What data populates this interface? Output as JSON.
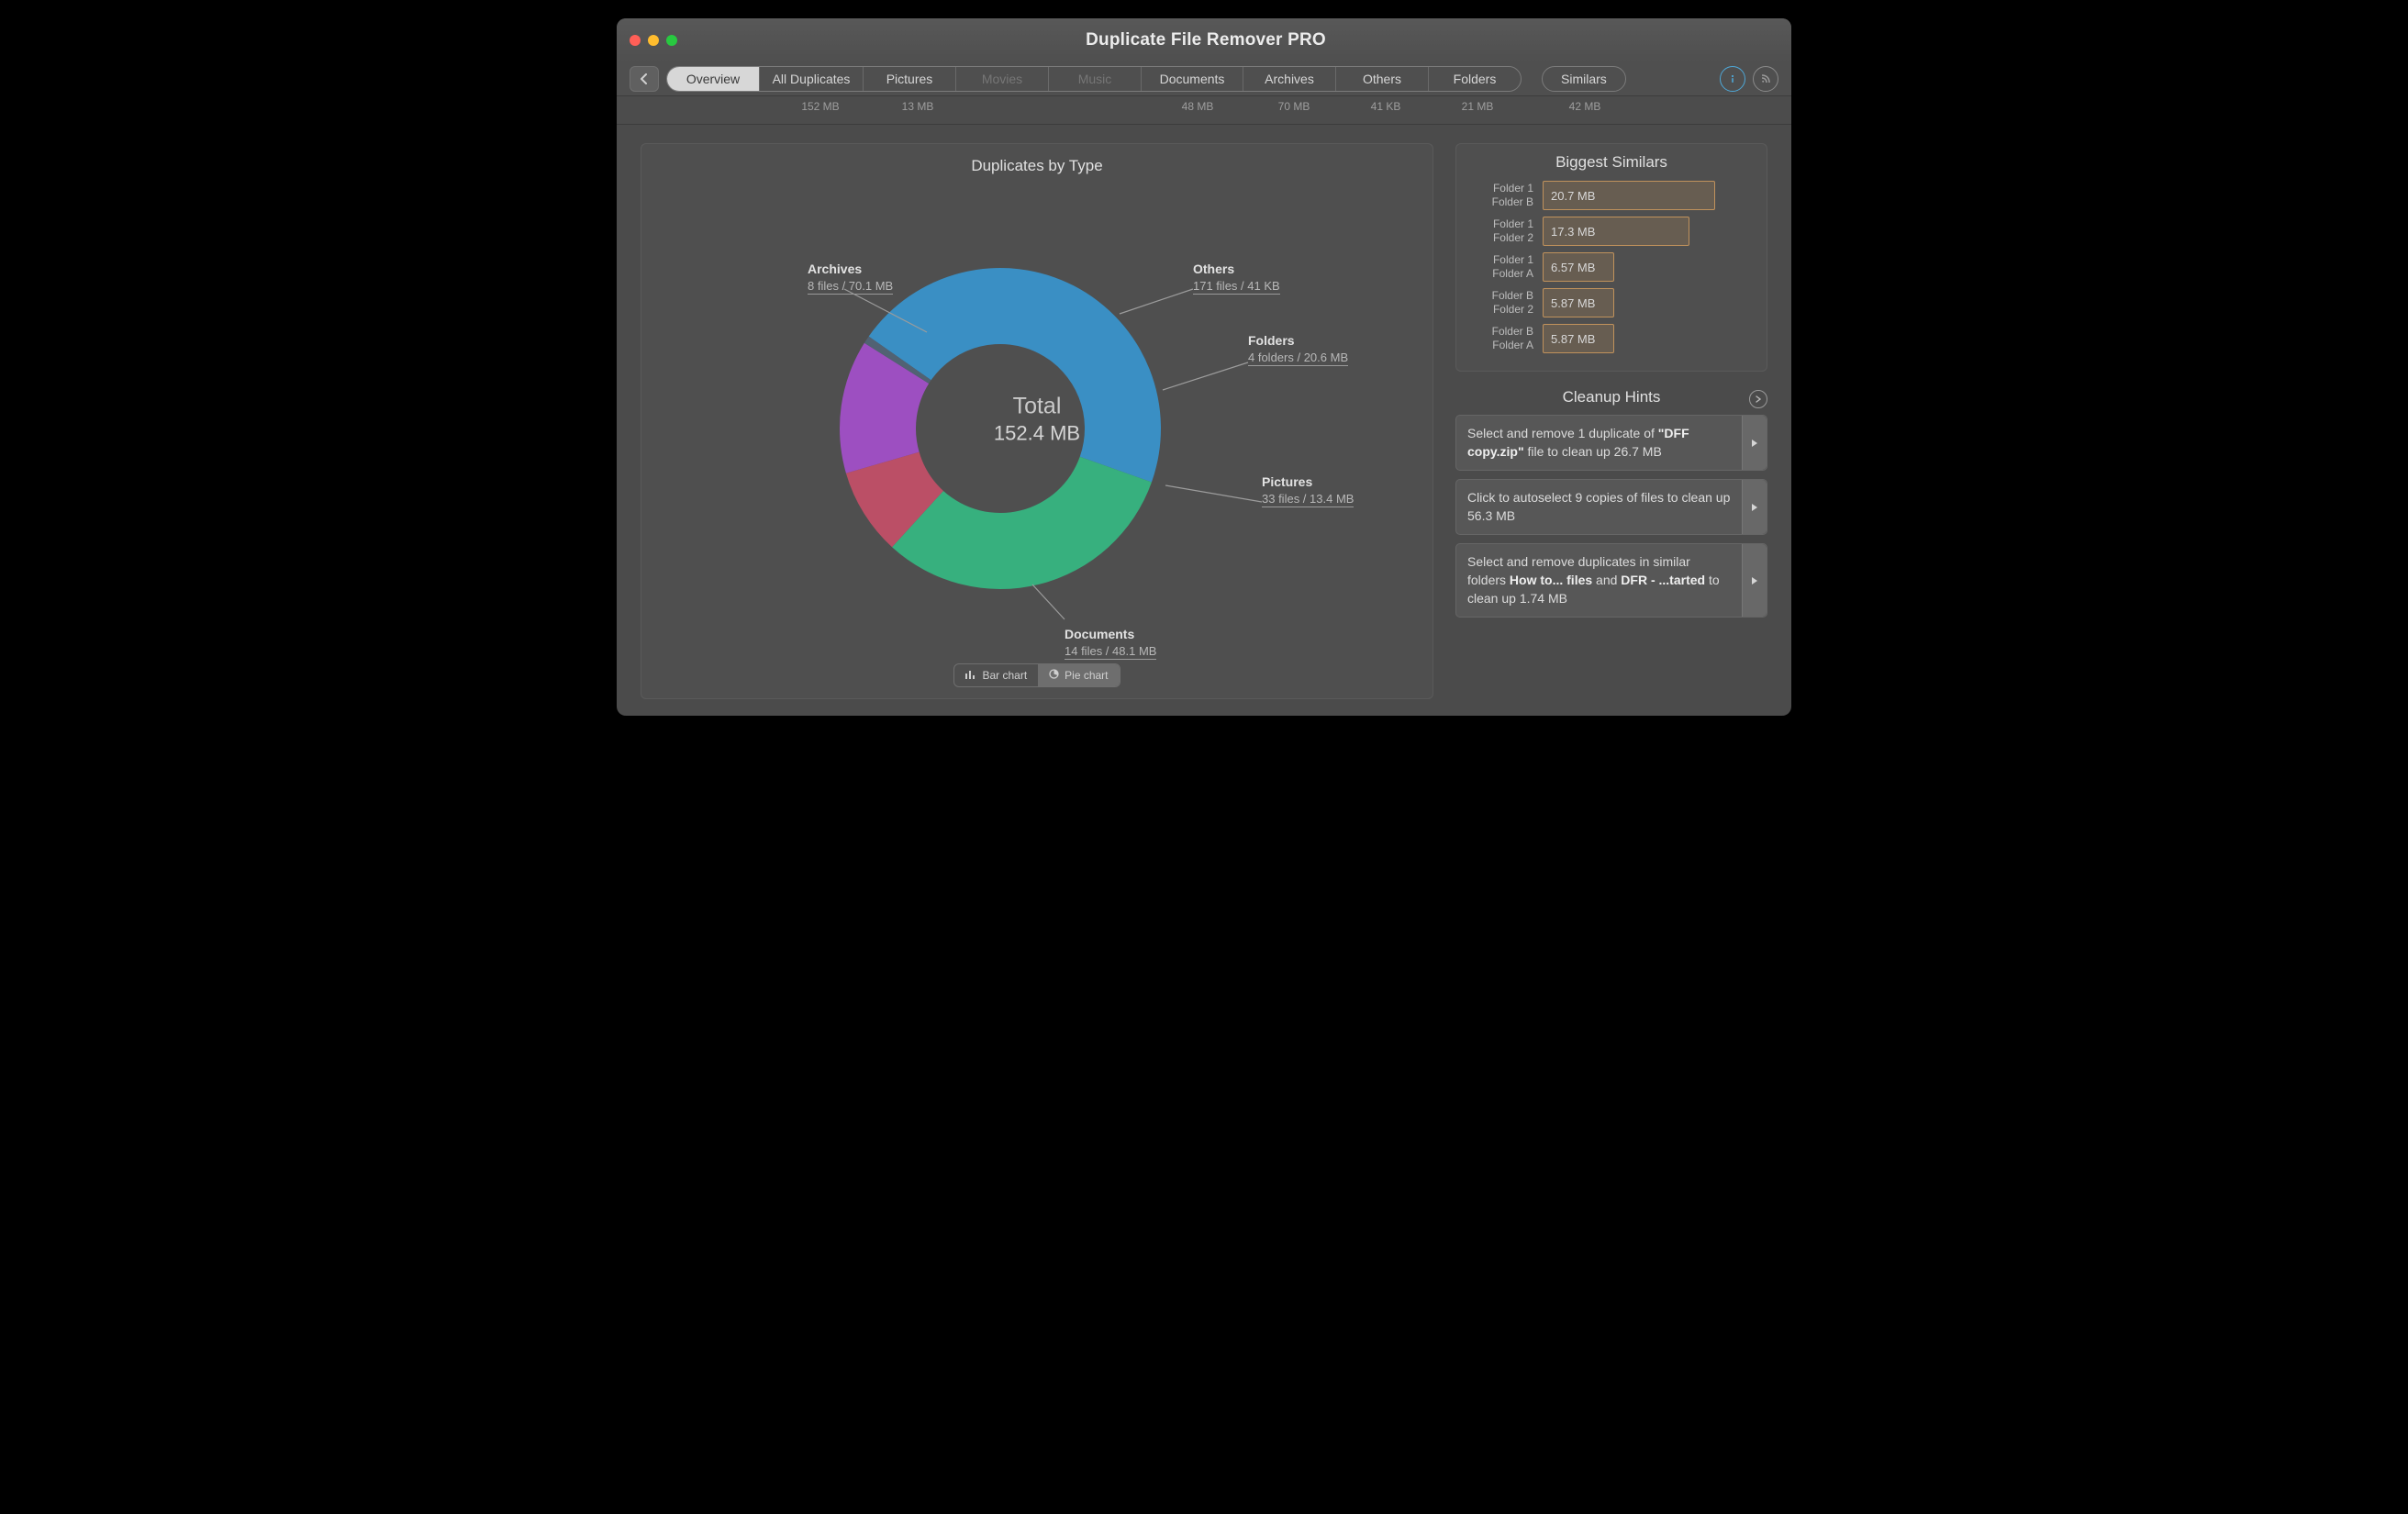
{
  "window": {
    "title": "Duplicate File Remover PRO"
  },
  "tabs": [
    {
      "label": "Overview",
      "size": "",
      "active": true,
      "dim": false,
      "w": 100
    },
    {
      "label": "All Duplicates",
      "size": "152 MB",
      "active": false,
      "dim": false,
      "w": 112
    },
    {
      "label": "Pictures",
      "size": "13 MB",
      "active": false,
      "dim": false,
      "w": 100
    },
    {
      "label": "Movies",
      "size": "",
      "active": false,
      "dim": true,
      "w": 100
    },
    {
      "label": "Music",
      "size": "",
      "active": false,
      "dim": true,
      "w": 100
    },
    {
      "label": "Documents",
      "size": "48 MB",
      "active": false,
      "dim": false,
      "w": 110
    },
    {
      "label": "Archives",
      "size": "70 MB",
      "active": false,
      "dim": false,
      "w": 100
    },
    {
      "label": "Others",
      "size": "41 KB",
      "active": false,
      "dim": false,
      "w": 100
    },
    {
      "label": "Folders",
      "size": "21 MB",
      "active": false,
      "dim": false,
      "w": 100
    }
  ],
  "similars_tab": {
    "label": "Similars",
    "size": "42 MB"
  },
  "chart": {
    "title": "Duplicates by Type",
    "total_label": "Total",
    "total_value": "152.4 MB",
    "toggle": {
      "bar": "Bar chart",
      "pie": "Pie chart",
      "active": "pie"
    }
  },
  "chart_data": {
    "type": "pie",
    "title": "Duplicates by Type",
    "series": [
      {
        "name": "Archives",
        "value_mb": 70.1,
        "files": "8 files",
        "detail": "8 files / 70.1 MB",
        "color": "#3a8fc4"
      },
      {
        "name": "Documents",
        "value_mb": 48.1,
        "files": "14 files",
        "detail": "14 files / 48.1 MB",
        "color": "#37b07e"
      },
      {
        "name": "Pictures",
        "value_mb": 13.4,
        "files": "33 files",
        "detail": "33 files / 13.4 MB",
        "color": "#bb4f66"
      },
      {
        "name": "Folders",
        "value_mb": 20.6,
        "files": "4 folders",
        "detail": "4 folders / 20.6 MB",
        "color": "#9d4fc1"
      },
      {
        "name": "Others",
        "value_mb": 0.04,
        "files": "171 files",
        "detail": "171 files / 41 KB",
        "color": "#516273"
      }
    ],
    "total_mb": 152.4
  },
  "biggest_similars": {
    "title": "Biggest Similars",
    "max_mb": 20.7,
    "rows": [
      {
        "a": "Folder 1",
        "b": "Folder B",
        "size": "20.7 MB",
        "mb": 20.7
      },
      {
        "a": "Folder 1",
        "b": "Folder 2",
        "size": "17.3 MB",
        "mb": 17.3
      },
      {
        "a": "Folder 1",
        "b": "Folder A",
        "size": "6.57 MB",
        "mb": 6.57
      },
      {
        "a": "Folder B",
        "b": "Folder 2",
        "size": "5.87 MB",
        "mb": 5.87
      },
      {
        "a": "Folder B",
        "b": "Folder A",
        "size": "5.87 MB",
        "mb": 5.87
      }
    ]
  },
  "cleanup": {
    "title": "Cleanup Hints",
    "hints": [
      {
        "pre": "Select and remove 1 duplicate of ",
        "bold1": "\"DFF copy.zip\"",
        "mid": " file to clean up 26.7 MB",
        "bold2": "",
        "post": ""
      },
      {
        "pre": "Click to autoselect 9 copies of files to clean up 56.3 MB",
        "bold1": "",
        "mid": "",
        "bold2": "",
        "post": ""
      },
      {
        "pre": "Select and remove duplicates in similar folders ",
        "bold1": "How to... files",
        "mid": " and ",
        "bold2": "DFR - ...tarted",
        "post": " to clean up 1.74 MB"
      }
    ]
  }
}
